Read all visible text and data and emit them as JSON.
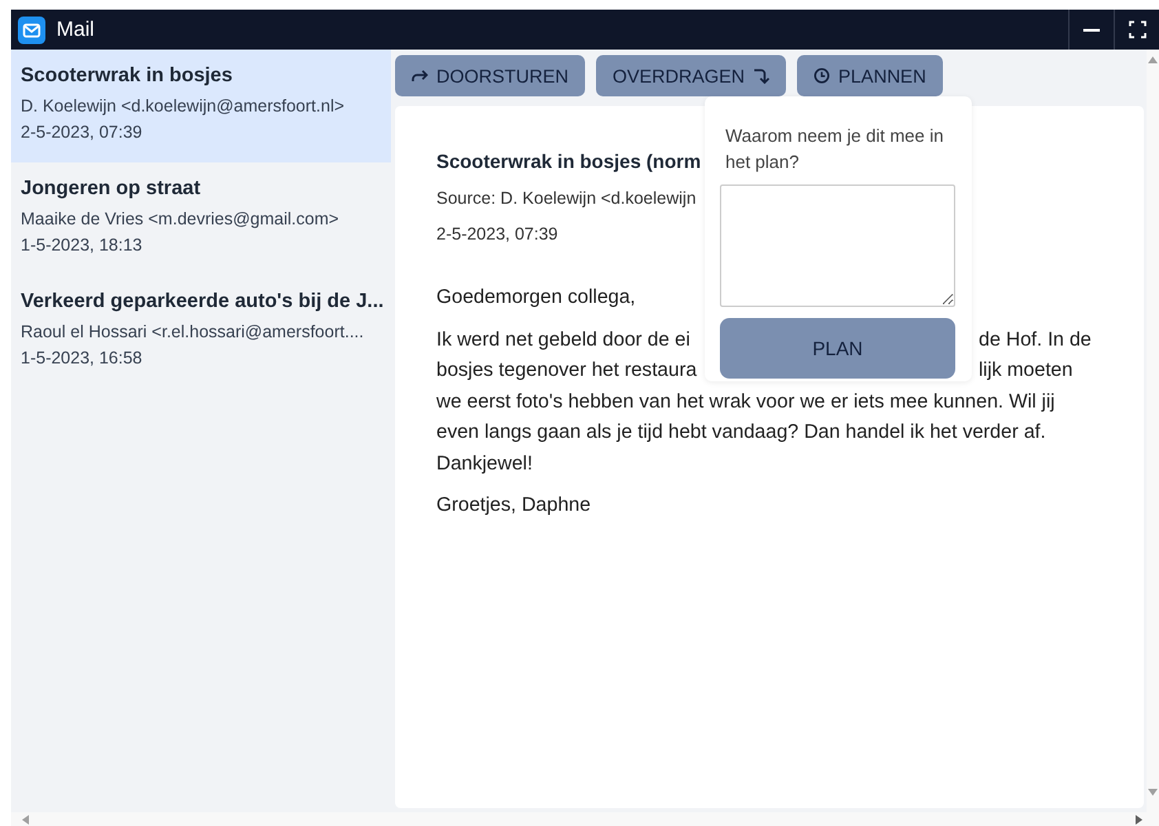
{
  "window": {
    "title": "Mail"
  },
  "messages": [
    {
      "subject": "Scooterwrak in bosjes",
      "sender": "D. Koelewijn <d.koelewijn@amersfoort.nl>",
      "date": "2-5-2023, 07:39",
      "selected": true
    },
    {
      "subject": "Jongeren op straat",
      "sender": "Maaike de Vries <m.devries@gmail.com>",
      "date": "1-5-2023, 18:13",
      "selected": false
    },
    {
      "subject": "Verkeerd geparkeerde auto's bij de J...",
      "sender": "Raoul el Hossari <r.el.hossari@amersfoort....",
      "date": "1-5-2023, 16:58",
      "selected": false
    }
  ],
  "toolbar": [
    {
      "label": "DOORSTUREN",
      "kind": "forward"
    },
    {
      "label": "OVERDRAGEN",
      "kind": "transfer"
    },
    {
      "label": "PLANNEN",
      "kind": "schedule"
    }
  ],
  "email": {
    "subject": "Scooterwrak in bosjes (norm",
    "source": "Source: D. Koelewijn <d.koelewijn",
    "date": "2-5-2023, 07:39",
    "paragraphs": [
      {
        "lines": [
          {
            "kind": "full",
            "text": "Goedemorgen collega,"
          }
        ]
      },
      {
        "lines": [
          {
            "kind": "split",
            "left": "Ik werd net gebeld door de ei",
            "right": "de Hof. In de"
          },
          {
            "kind": "split",
            "left": "bosjes tegenover het restaura",
            "right": "lijk moeten"
          },
          {
            "kind": "full",
            "text": "we eerst foto's hebben van het wrak voor we er iets mee kunnen. Wil jij"
          },
          {
            "kind": "full",
            "text": "even langs gaan als je tijd hebt vandaag? Dan handel ik het verder af."
          },
          {
            "kind": "full",
            "text": "Dankjewel!"
          }
        ]
      },
      {
        "lines": [
          {
            "kind": "full",
            "text": "Groetjes, Daphne"
          }
        ]
      }
    ]
  },
  "plan_popover": {
    "question": "Waarom neem je dit mee in het plan?",
    "button": "PLAN"
  }
}
